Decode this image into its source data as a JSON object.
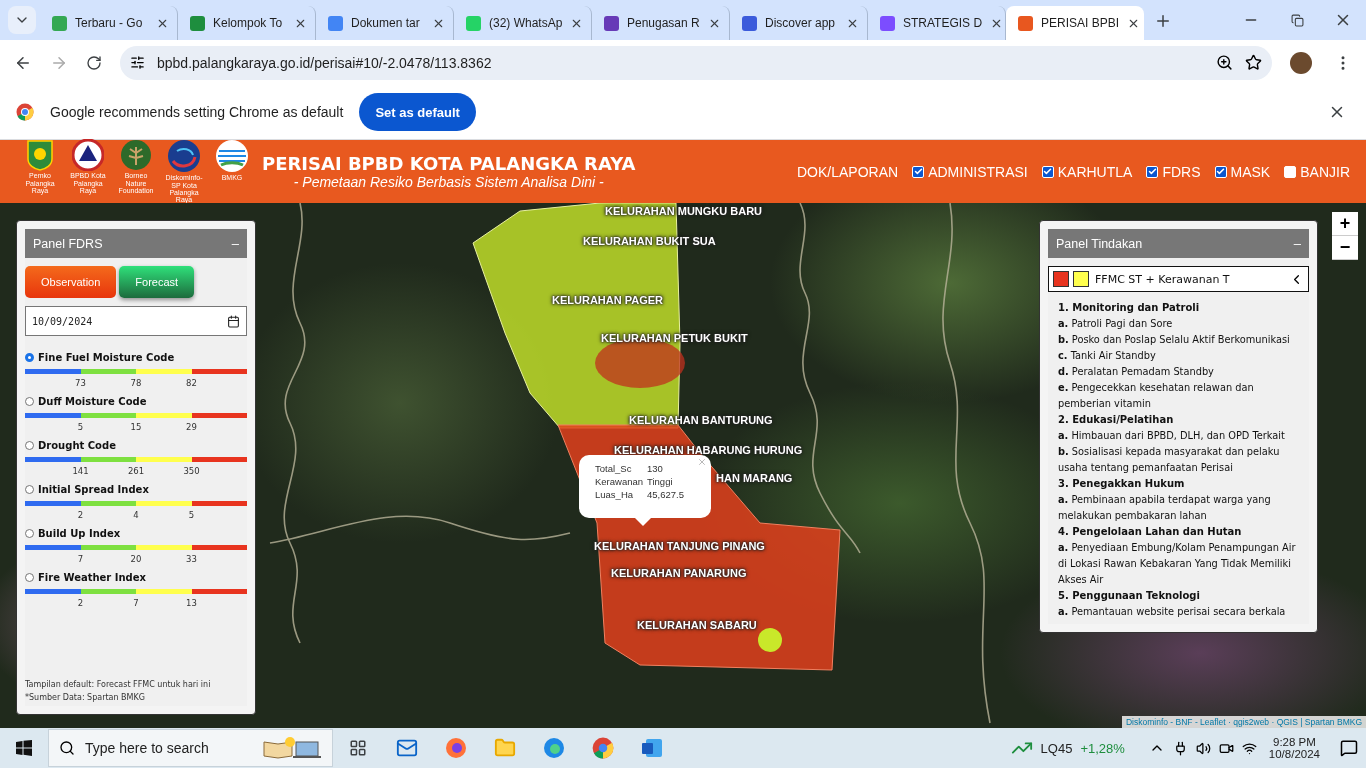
{
  "browser": {
    "tabs": [
      {
        "title": "Terbaru - Go",
        "color": "#34a853",
        "selected": false
      },
      {
        "title": "Kelompok To",
        "color": "#1e8e3e",
        "selected": false
      },
      {
        "title": "Dokumen tar",
        "color": "#4285f4",
        "selected": false
      },
      {
        "title": "(32) WhatsAp",
        "color": "#25d366",
        "selected": false
      },
      {
        "title": "Penugasan R",
        "color": "#673ab7",
        "selected": false
      },
      {
        "title": "Discover app",
        "color": "#3b5bdb",
        "selected": false
      },
      {
        "title": "STRATEGIS D",
        "color": "#7c4dff",
        "selected": false
      },
      {
        "title": "PERISAI BPBI",
        "color": "#e8571f",
        "selected": true
      }
    ],
    "address": "bpbd.palangkaraya.go.id/perisai#10/-2.0478/113.8362"
  },
  "infobar": {
    "message": "Google recommends setting Chrome as default",
    "button": "Set as default"
  },
  "header": {
    "logos": [
      {
        "kind": "shield",
        "caption": "Pemko Palangka Raya"
      },
      {
        "kind": "triangle",
        "caption": "BPBD Kota Palangka Raya"
      },
      {
        "kind": "tree",
        "caption": "Borneo Nature Foundation"
      },
      {
        "kind": "swirl",
        "caption": "Diskominfo-SP Kota Palangka Raya"
      },
      {
        "kind": "wave",
        "caption": "BMKG"
      }
    ],
    "title": "PERISAI BPBD KOTA PALANGKA RAYA",
    "subtitle": "- Pemetaan Resiko Berbasis Sistem Analisa Dini -",
    "nav": [
      {
        "kind": "link",
        "label": "DOK/LAPORAN"
      },
      {
        "kind": "checkbox",
        "label": "ADMINISTRASI",
        "checked": true
      },
      {
        "kind": "checkbox",
        "label": "KARHUTLA",
        "checked": true
      },
      {
        "kind": "checkbox",
        "label": "FDRS",
        "checked": true
      },
      {
        "kind": "checkbox",
        "label": "MASK",
        "checked": true
      },
      {
        "kind": "checkbox",
        "label": "BANJIR",
        "checked": false
      }
    ]
  },
  "map": {
    "labels": [
      "KELURAHAN MUNGKU BARU",
      "KELURAHAN BUKIT SUA",
      "KELURAHAN PAGER",
      "KELURAHAN PETUK BUKIT",
      "KELURAHAN BANTURUNG",
      "KELURAHAN HABARUNG HURUNG",
      "HAN MARANG",
      "KELURAHAN TANJUNG PINANG",
      "KELURAHAN PANARUNG",
      "KELURAHAN SABARU"
    ],
    "popup": {
      "rows": [
        {
          "key": "Total_Sc",
          "value": "130"
        },
        {
          "key": "Kerawanan",
          "value": "Tinggi"
        },
        {
          "key": "Luas_Ha",
          "value": "45,627.5"
        }
      ]
    },
    "zoom": [
      "+",
      "−"
    ],
    "attribution": "Diskominfo - BNF - Leaflet · qgis2web · QGIS | Spartan BMKG"
  },
  "fdrs_panel": {
    "title": "Panel FDRS",
    "collapse": "–",
    "buttons": [
      {
        "kind": "observation",
        "label": "Observation"
      },
      {
        "kind": "forecast",
        "label": "Forecast"
      }
    ],
    "date": "10/09/2024",
    "indices": [
      {
        "name": "Fine Fuel Moisture Code",
        "selected": true,
        "ticks": [
          "73",
          "78",
          "82"
        ]
      },
      {
        "name": "Duff Moisture Code",
        "selected": false,
        "ticks": [
          "5",
          "15",
          "29"
        ]
      },
      {
        "name": "Drought Code",
        "selected": false,
        "ticks": [
          "141",
          "261",
          "350"
        ]
      },
      {
        "name": "Initial Spread Index",
        "selected": false,
        "ticks": [
          "2",
          "4",
          "5"
        ]
      },
      {
        "name": "Build Up Index",
        "selected": false,
        "ticks": [
          "7",
          "20",
          "33"
        ]
      },
      {
        "name": "Fire Weather Index",
        "selected": false,
        "ticks": [
          "2",
          "7",
          "13"
        ]
      }
    ],
    "notes": [
      "Tampilan default: Forecast FFMC untuk hari ini",
      "*Sumber Data: Spartan BMKG"
    ]
  },
  "tindakan_panel": {
    "title": "Panel Tindakan",
    "collapse": "–",
    "legend": {
      "swatches": [
        {
          "color": "#e8341f"
        },
        {
          "color": "#ffff4d"
        }
      ],
      "label": "FFMC ST + Kerawanan T"
    },
    "sections": [
      {
        "heading": "1. Monitoring dan Patroli",
        "items": [
          "**a.** Patroli Pagi dan Sore",
          "**b.** Posko dan Poslap Selalu Aktif Berkomunikasi",
          "**c.** Tanki Air Standby",
          "**d.** Peralatan Pemadam Standby",
          "**e.** Pengecekkan kesehatan relawan dan pemberian vitamin"
        ]
      },
      {
        "heading": "2. Edukasi/Pelatihan",
        "items": [
          "**a.** Himbauan dari BPBD, DLH, dan OPD Terkait",
          "**b.** Sosialisasi kepada masyarakat dan pelaku usaha tentang pemanfaatan Perisai"
        ]
      },
      {
        "heading": "3. Penegakkan Hukum",
        "items": [
          "**a.** Pembinaan apabila terdapat warga yang melakukan pembakaran lahan"
        ]
      },
      {
        "heading": "4. Pengelolaan Lahan dan Hutan",
        "items": [
          "**a.** Penyediaan Embung/Kolam Penampungan Air di Lokasi Rawan Kebakaran Yang Tidak Memiliki Akses Air"
        ]
      },
      {
        "heading": "5. Penggunaan Teknologi",
        "items": [
          "**a.** Pemantauan website perisai secara berkala"
        ]
      }
    ]
  },
  "taskbar": {
    "search": "Type here to search",
    "stock": {
      "symbol": "LQ45",
      "change": "+1,28%"
    },
    "time": "9:28 PM",
    "date": "10/8/2024"
  }
}
